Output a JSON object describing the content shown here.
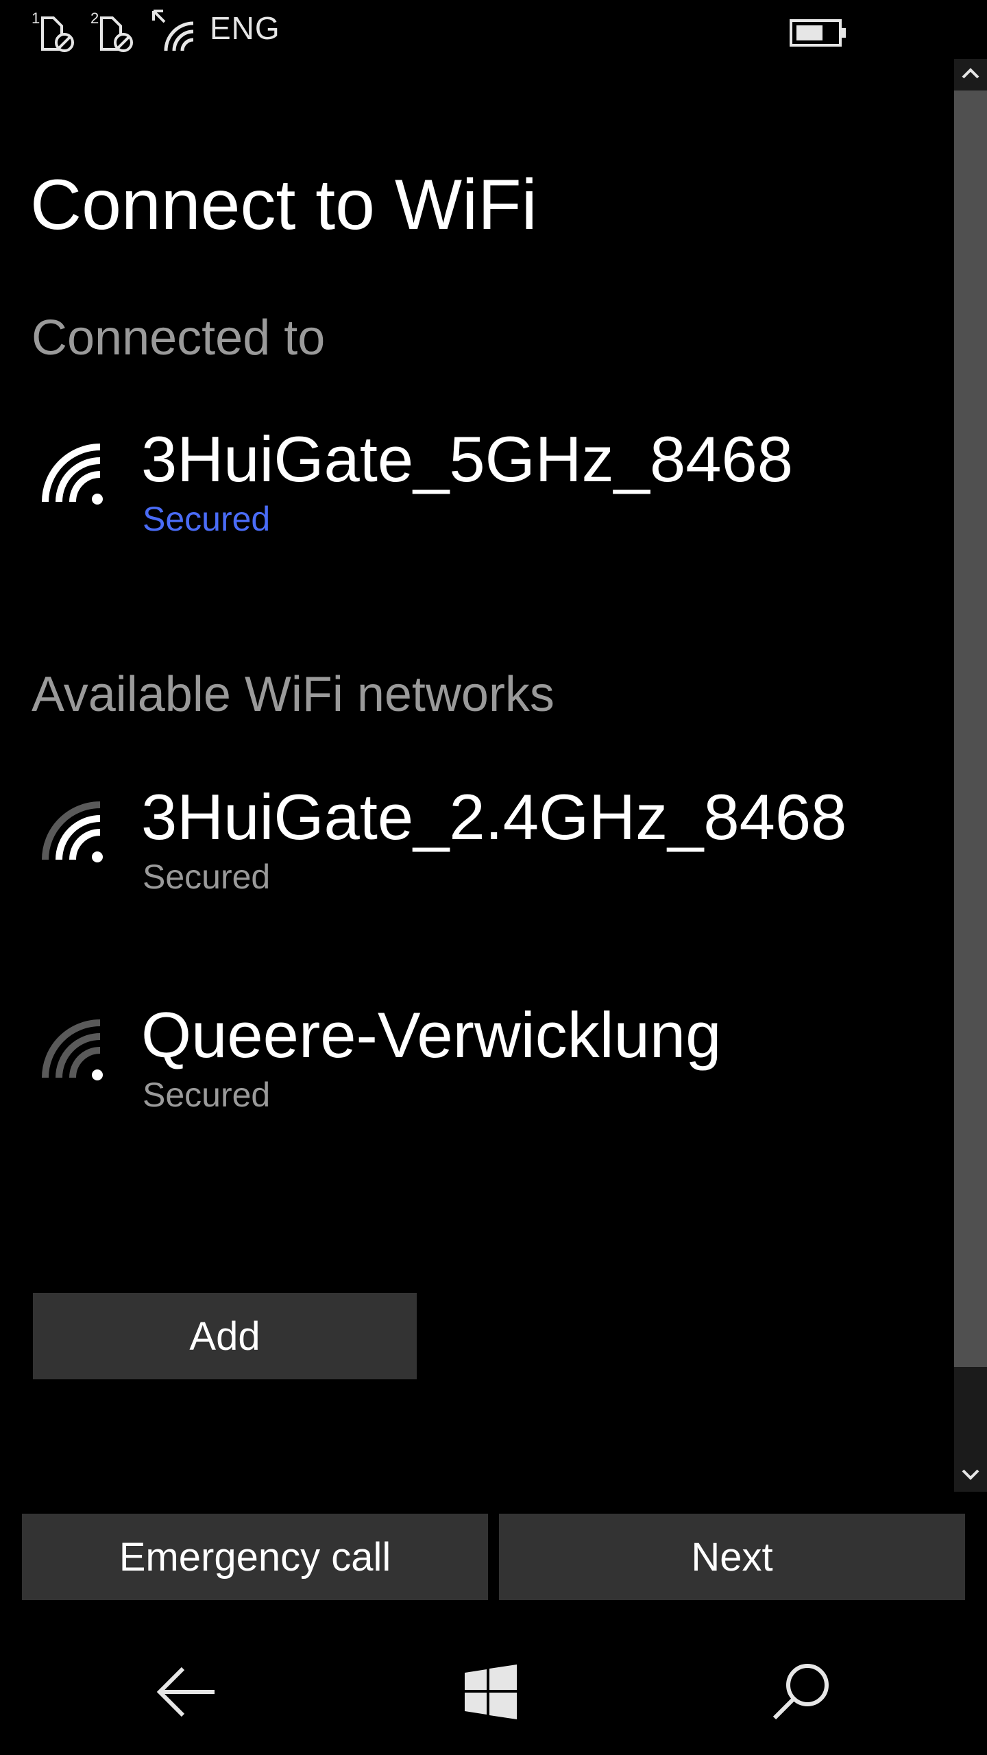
{
  "status_bar": {
    "sim1_label": "1",
    "sim2_label": "2",
    "language": "ENG",
    "icons": [
      "sim1-no-service-icon",
      "sim2-no-service-icon",
      "wifi-signal-icon",
      "battery-icon"
    ]
  },
  "page": {
    "title": "Connect to WiFi"
  },
  "connected_section": {
    "header": "Connected to",
    "network": {
      "name": "3HuiGate_5GHz_8468",
      "status": "Secured",
      "status_color": "#4a6cf7",
      "icon": "wifi-full-icon"
    }
  },
  "available_section": {
    "header": "Available WiFi networks",
    "networks": [
      {
        "name": "3HuiGate_2.4GHz_8468",
        "status": "Secured",
        "icon": "wifi-strong-icon"
      },
      {
        "name": "Queere-Verwicklung",
        "status": "Secured",
        "icon": "wifi-weak-icon"
      }
    ]
  },
  "actions": {
    "add_label": "Add",
    "emergency_label": "Emergency call",
    "next_label": "Next"
  },
  "nav": {
    "icons": [
      "back-arrow-icon",
      "windows-logo-icon",
      "search-icon"
    ]
  },
  "colors": {
    "background": "#000000",
    "button": "#333333",
    "accent": "#4a6cf7",
    "secondary_text": "#9a9a9a"
  }
}
